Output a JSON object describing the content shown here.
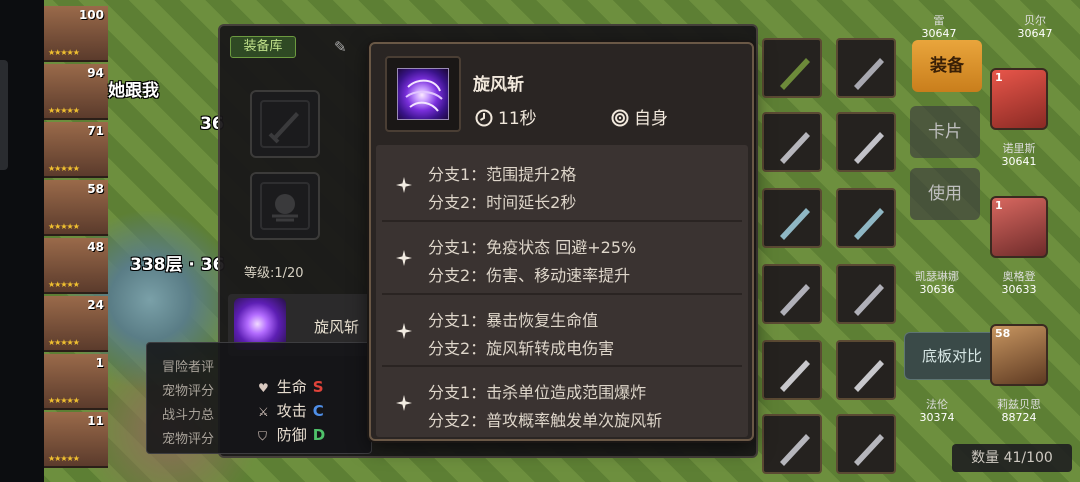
{
  "scene": {
    "heroes": [
      {
        "num": "100"
      },
      {
        "num": "94"
      },
      {
        "num": "71"
      },
      {
        "num": "58"
      },
      {
        "num": "48"
      },
      {
        "num": "24"
      },
      {
        "num": "1"
      },
      {
        "num": "11"
      }
    ],
    "chat_text": "她跟我",
    "floor_text": "338层 · 36",
    "floor_text2": "36"
  },
  "equip_window": {
    "store_tab": "装备库",
    "level": "等级:1/20",
    "skill_name": "旋风斩",
    "stats": [
      {
        "label": "生命",
        "grade": "S",
        "color": "#e0433a"
      },
      {
        "label": "攻击",
        "grade": "C",
        "color": "#4f8fe8"
      },
      {
        "label": "防御",
        "grade": "D",
        "color": "#4fc26a"
      }
    ],
    "advent_lines": [
      "冒险者评",
      "宠物评分",
      "战斗力总",
      "宠物评分"
    ]
  },
  "side_panel": {
    "equip_button": "装备",
    "card_button": "卡片",
    "use_button": "使用",
    "compare_button": "底板对比",
    "count_label": "数量 41/100",
    "portraits": [
      {
        "lv": "1",
        "name": "诺里斯",
        "power": "30641"
      },
      {
        "lv": "1",
        "name": "奥格登",
        "power": "30633"
      },
      {
        "lv": "58",
        "name": "莉兹贝思",
        "power": "88724"
      }
    ],
    "top_names": [
      {
        "name": "雷",
        "power": "30647"
      },
      {
        "name": "贝尔",
        "power": "30647"
      }
    ],
    "mid_names": [
      {
        "name": "凯瑟琳娜",
        "power": "30636"
      },
      {
        "name": "法伦",
        "power": "30374"
      }
    ]
  },
  "tooltip": {
    "skill_name": "旋风斩",
    "cooldown": "11秒",
    "target": "自身",
    "branches": [
      {
        "b1": "分支1：范围提升2格",
        "b2": "分支2：时间延长2秒"
      },
      {
        "b1": "分支1：免疫状态 回避+25%",
        "b2": "分支2：伤害、移动速率提升"
      },
      {
        "b1": "分支1：暴击恢复生命值",
        "b2": "分支2：旋风斩转成电伤害"
      },
      {
        "b1": "分支1：击杀单位造成范围爆炸",
        "b2": "分支2：普攻概率触发单次旋风斩"
      }
    ]
  }
}
